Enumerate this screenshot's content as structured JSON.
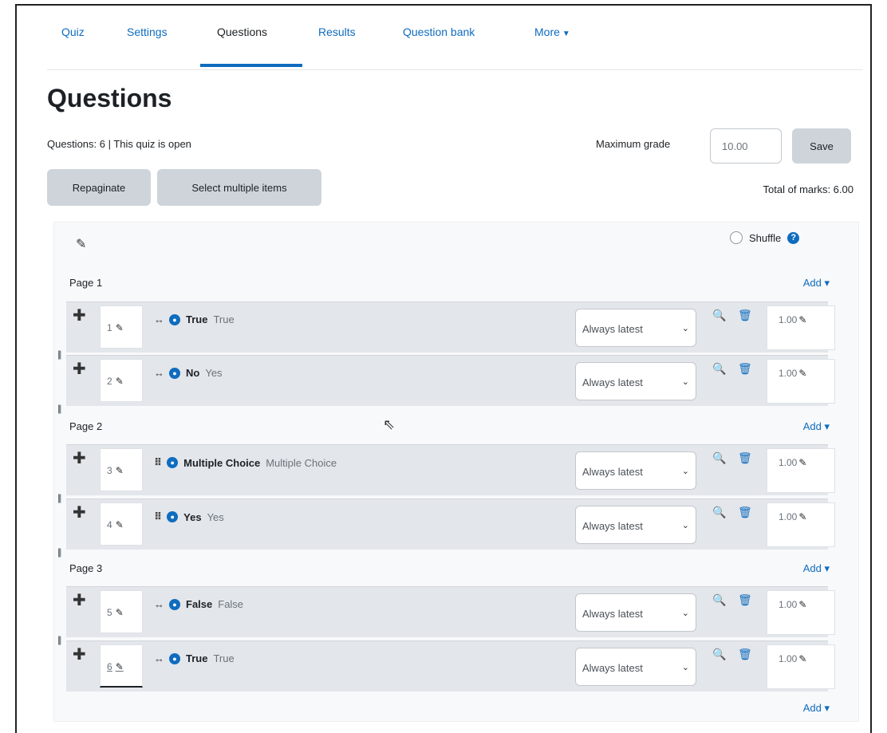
{
  "tabs": [
    {
      "label": "Quiz"
    },
    {
      "label": "Settings"
    },
    {
      "label": "Questions"
    },
    {
      "label": "Results"
    },
    {
      "label": "Question bank"
    },
    {
      "label": "More"
    }
  ],
  "page_title": "Questions",
  "status_text": "Questions: 6 | This quiz is open",
  "max_grade": {
    "label": "Maximum grade",
    "value": "10.00"
  },
  "buttons": {
    "save": "Save",
    "repaginate": "Repaginate",
    "select_multiple": "Select multiple items"
  },
  "total_marks": "Total of marks: 6.00",
  "shuffle_label": "Shuffle",
  "add_label": "Add",
  "version_label": "Always latest",
  "pages": [
    {
      "label": "Page 1",
      "questions": [
        {
          "number": "1",
          "name": "True",
          "text": "True",
          "mark": "1.00"
        },
        {
          "number": "2",
          "name": "No",
          "text": "Yes",
          "mark": "1.00"
        }
      ]
    },
    {
      "label": "Page 2",
      "questions": [
        {
          "number": "3",
          "name": "Multiple Choice",
          "text": "Multiple Choice",
          "mark": "1.00"
        },
        {
          "number": "4",
          "name": "Yes",
          "text": "Yes",
          "mark": "1.00"
        }
      ]
    },
    {
      "label": "Page 3",
      "questions": [
        {
          "number": "5",
          "name": "False",
          "text": "False",
          "mark": "1.00"
        },
        {
          "number": "6",
          "name": "True",
          "text": "True",
          "mark": "1.00"
        }
      ]
    }
  ],
  "colors": {
    "accent": "#0f6cbf",
    "slot_bg": "#e3e6ea",
    "button_bg": "#ced4da"
  }
}
